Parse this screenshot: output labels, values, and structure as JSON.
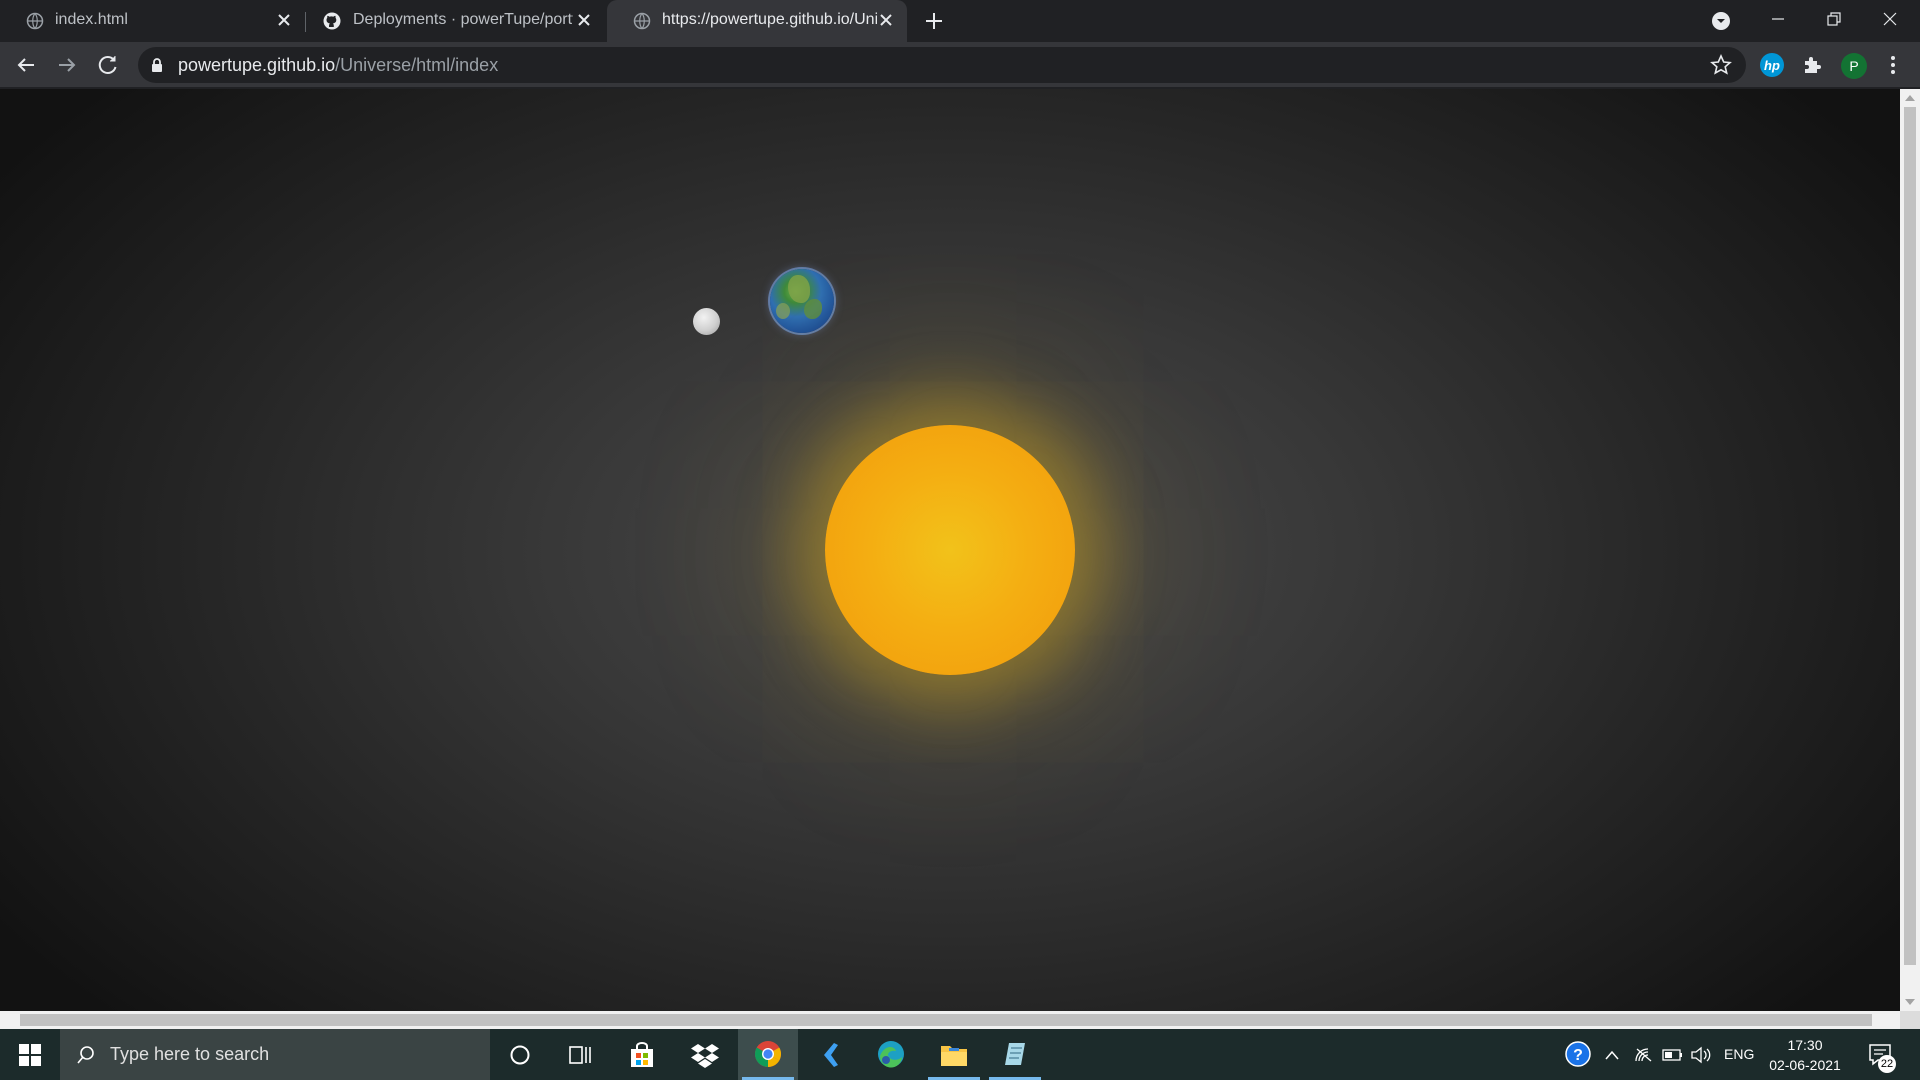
{
  "browser": {
    "tabs": [
      {
        "title": "index.html",
        "icon": "globe-icon",
        "active": false
      },
      {
        "title": "Deployments · powerTupe/portfo",
        "icon": "github-icon",
        "active": false
      },
      {
        "title": "https://powertupe.github.io/Univ",
        "icon": "globe-icon",
        "active": true
      }
    ],
    "address": {
      "host": "powertupe.github.io",
      "path": "/Universe/html/index"
    },
    "profile_initial": "P"
  },
  "page": {
    "scene": "solar-system",
    "colors": {
      "sun": "#f4ae12",
      "background": "#383838"
    }
  },
  "taskbar": {
    "search_placeholder": "Type here to search",
    "language": "ENG",
    "time": "17:30",
    "date": "02-06-2021",
    "notification_count": "22"
  }
}
